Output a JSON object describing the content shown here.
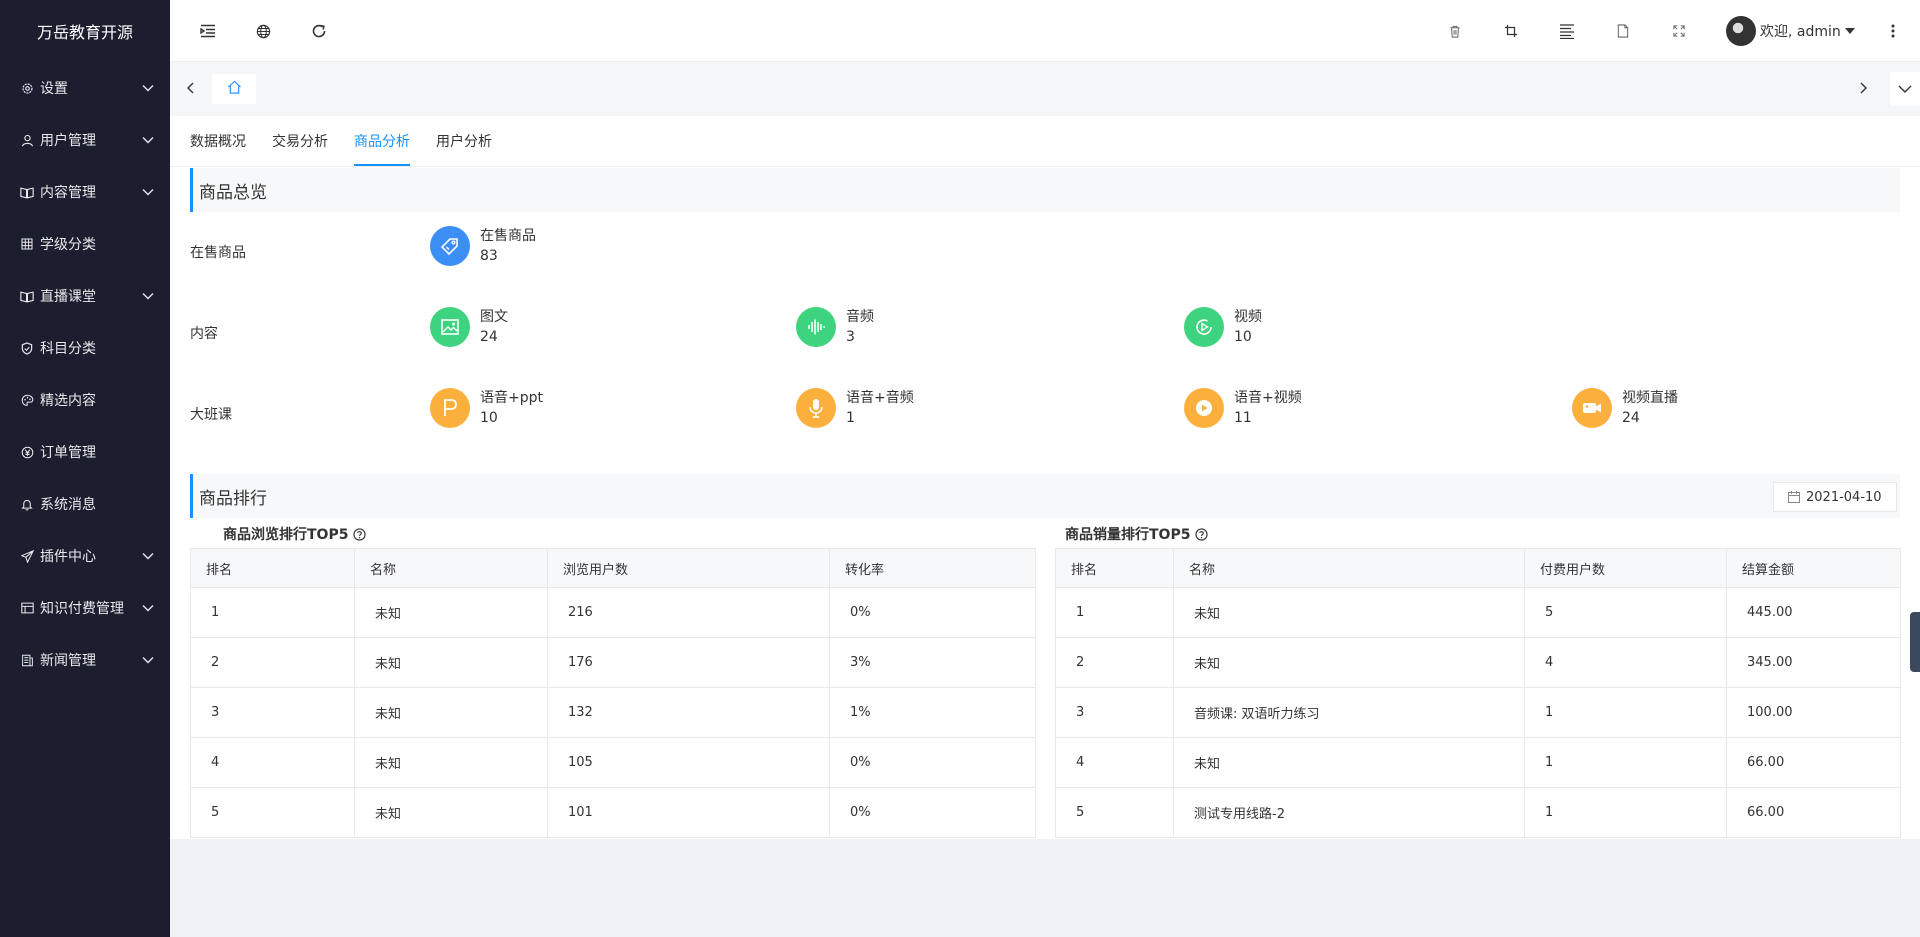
{
  "app": {
    "title": "万岳教育开源"
  },
  "colors": {
    "accent": "#1890ff",
    "sidebar_bg": "#1b1e2f",
    "blue": "#3b8ff4",
    "green": "#3ed37e",
    "orange": "#fbb03d"
  },
  "sidebar": {
    "items": [
      {
        "label": "设置",
        "icon": "gear-icon",
        "expandable": true
      },
      {
        "label": "用户管理",
        "icon": "user-icon",
        "expandable": true
      },
      {
        "label": "内容管理",
        "icon": "book-icon",
        "expandable": true
      },
      {
        "label": "学级分类",
        "icon": "grid-icon",
        "expandable": false
      },
      {
        "label": "直播课堂",
        "icon": "book-icon",
        "expandable": true
      },
      {
        "label": "科目分类",
        "icon": "shield-icon",
        "expandable": false
      },
      {
        "label": "精选内容",
        "icon": "palette-icon",
        "expandable": false
      },
      {
        "label": "订单管理",
        "icon": "yen-icon",
        "expandable": false
      },
      {
        "label": "系统消息",
        "icon": "bell-icon",
        "expandable": false
      },
      {
        "label": "插件中心",
        "icon": "send-icon",
        "expandable": true
      },
      {
        "label": "知识付费管理",
        "icon": "table-icon",
        "expandable": true
      },
      {
        "label": "新闻管理",
        "icon": "news-icon",
        "expandable": true
      }
    ]
  },
  "header": {
    "user": "欢迎, admin",
    "icons": [
      "menu-fold-icon",
      "globe-icon",
      "refresh-icon",
      "trash-icon",
      "crop-icon",
      "align-icon",
      "file-icon",
      "fullscreen-icon",
      "more-icon"
    ]
  },
  "subtabs": [
    {
      "label": "数据概况",
      "active": false
    },
    {
      "label": "交易分析",
      "active": false
    },
    {
      "label": "商品分析",
      "active": true
    },
    {
      "label": "用户分析",
      "active": false
    }
  ],
  "overview": {
    "title": "商品总览",
    "rows": [
      {
        "label": "在售商品",
        "stats": [
          {
            "name": "在售商品",
            "value": "83",
            "icon": "tag-icon",
            "color": "#3b8ff4"
          }
        ]
      },
      {
        "label": "内容",
        "stats": [
          {
            "name": "图文",
            "value": "24",
            "icon": "image-icon",
            "color": "#3ed37e"
          },
          {
            "name": "音频",
            "value": "3",
            "icon": "audio-wave-icon",
            "color": "#3ed37e"
          },
          {
            "name": "视频",
            "value": "10",
            "icon": "video-play-icon",
            "color": "#3ed37e"
          }
        ]
      },
      {
        "label": "大班课",
        "stats": [
          {
            "name": "语音+ppt",
            "value": "10",
            "icon": "ppt-icon",
            "color": "#fbb03d"
          },
          {
            "name": "语音+音频",
            "value": "1",
            "icon": "mic-icon",
            "color": "#fbb03d"
          },
          {
            "name": "语音+视频",
            "value": "11",
            "icon": "play-icon",
            "color": "#fbb03d"
          },
          {
            "name": "视频直播",
            "value": "24",
            "icon": "camera-icon",
            "color": "#fbb03d"
          }
        ]
      }
    ]
  },
  "ranking": {
    "title": "商品排行",
    "date": "2021-04-10",
    "browse": {
      "title": "商品浏览排行TOP5",
      "columns": [
        "排名",
        "名称",
        "浏览用户数",
        "转化率"
      ],
      "rows": [
        [
          "1",
          "未知",
          "216",
          "0%"
        ],
        [
          "2",
          "未知",
          "176",
          "3%"
        ],
        [
          "3",
          "未知",
          "132",
          "1%"
        ],
        [
          "4",
          "未知",
          "105",
          "0%"
        ],
        [
          "5",
          "未知",
          "101",
          "0%"
        ]
      ]
    },
    "sales": {
      "title": "商品销量排行TOP5",
      "columns": [
        "排名",
        "名称",
        "付费用户数",
        "结算金额"
      ],
      "rows": [
        [
          "1",
          "未知",
          "5",
          "445.00"
        ],
        [
          "2",
          "未知",
          "4",
          "345.00"
        ],
        [
          "3",
          "音频课: 双语听力练习",
          "1",
          "100.00"
        ],
        [
          "4",
          "未知",
          "1",
          "66.00"
        ],
        [
          "5",
          "测试专用线路-2",
          "1",
          "66.00"
        ]
      ]
    }
  }
}
